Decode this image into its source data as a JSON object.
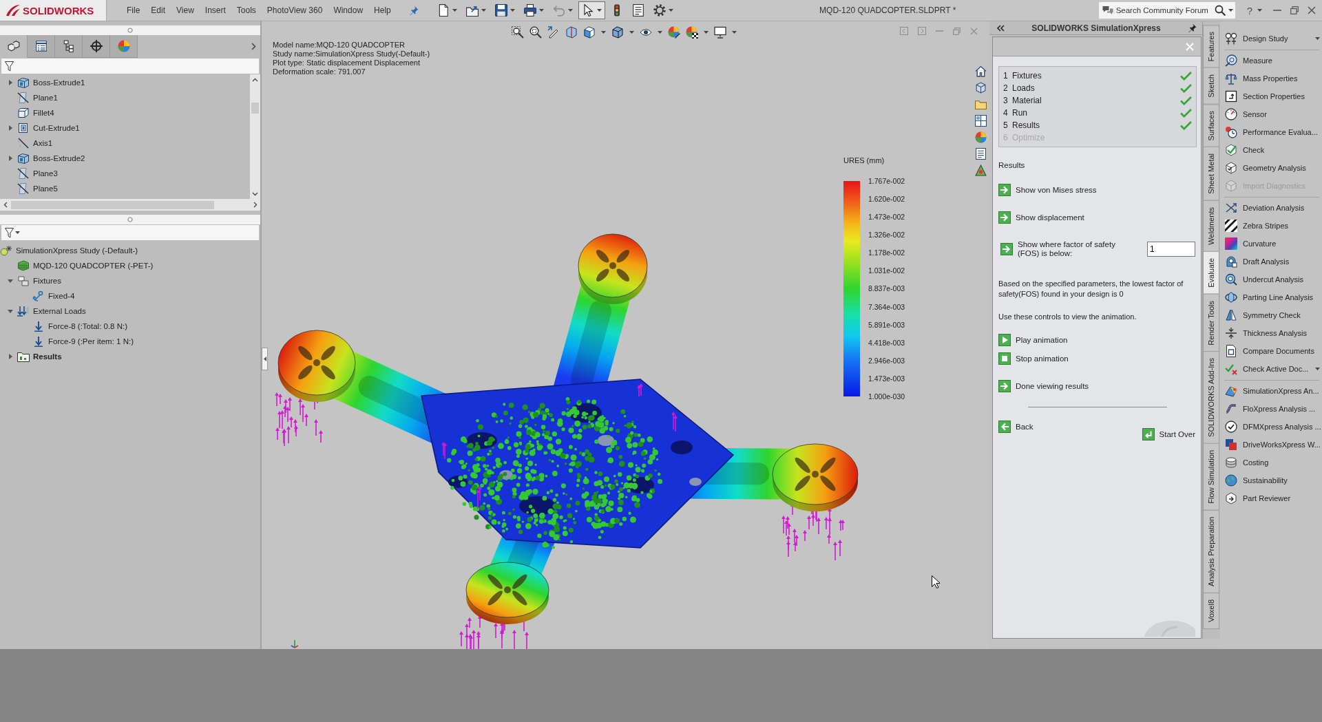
{
  "window": {
    "logo": "SOLIDWORKS",
    "title": "MQD-120 QUADCOPTER.SLDPRT *",
    "help": "?"
  },
  "menu": [
    "File",
    "Edit",
    "View",
    "Insert",
    "Tools",
    "PhotoView 360",
    "Window",
    "Help"
  ],
  "toolbar": [
    {
      "kind": "new",
      "dropdown": true,
      "disabled": false,
      "pressed": false
    },
    {
      "kind": "open",
      "dropdown": true,
      "disabled": false,
      "pressed": false
    },
    {
      "kind": "save",
      "dropdown": true,
      "disabled": false,
      "pressed": false
    },
    {
      "kind": "print",
      "dropdown": true,
      "disabled": false,
      "pressed": false
    },
    {
      "kind": "undo",
      "dropdown": true,
      "disabled": true,
      "pressed": false
    },
    {
      "kind": "select",
      "dropdown": true,
      "disabled": false,
      "pressed": true
    },
    {
      "kind": "rebuild",
      "dropdown": false,
      "disabled": false,
      "pressed": false
    },
    {
      "kind": "properties",
      "dropdown": false,
      "disabled": false,
      "pressed": false
    },
    {
      "kind": "options",
      "dropdown": true,
      "disabled": false,
      "pressed": false
    }
  ],
  "search": {
    "placeholder": "Search Community Forum"
  },
  "feature_manager": {
    "tabs": [
      {
        "kind": "features",
        "selected": true
      },
      {
        "kind": "properties",
        "selected": false
      },
      {
        "kind": "configurations",
        "selected": false
      },
      {
        "kind": "dimxpert",
        "selected": false
      },
      {
        "kind": "display",
        "selected": false
      }
    ],
    "tree": [
      {
        "kind": "extrude",
        "label": "Boss-Extrude1",
        "expanded": false
      },
      {
        "kind": "plane",
        "label": "Plane1"
      },
      {
        "kind": "fillet",
        "label": "Fillet4"
      },
      {
        "kind": "cut",
        "label": "Cut-Extrude1",
        "expanded": false
      },
      {
        "kind": "axis",
        "label": "Axis1"
      },
      {
        "kind": "extrude",
        "label": "Boss-Extrude2",
        "expanded": false
      },
      {
        "kind": "plane",
        "label": "Plane3"
      },
      {
        "kind": "plane",
        "label": "Plane5"
      }
    ]
  },
  "study_tree": [
    {
      "kind": "study",
      "label": "SimulationXpress Study (-Default-)",
      "children": [
        {
          "kind": "part",
          "label": "MQD-120 QUADCOPTER (-PET-)"
        },
        {
          "kind": "fixtures",
          "label": "Fixtures",
          "expanded": true,
          "children": [
            {
              "kind": "fixed",
              "label": "Fixed-4"
            }
          ]
        },
        {
          "kind": "loads",
          "label": "External Loads",
          "expanded": true,
          "children": [
            {
              "kind": "force",
              "label": "Force-8 (:Total: 0.8 N:)"
            },
            {
              "kind": "force",
              "label": "Force-9 (:Per item: 1 N:)"
            }
          ]
        },
        {
          "kind": "results",
          "label": "Results",
          "expanded": false
        }
      ]
    }
  ],
  "viewport": {
    "plot_info": [
      "Model name:MQD-120 QUADCOPTER",
      "Study name:SimulationXpress Study(-Default-)",
      "Plot type: Static displacement Displacement",
      "Deformation scale: 791.007"
    ],
    "legend": {
      "title": "URES (mm)",
      "labels": [
        "1.767e-002",
        "1.620e-002",
        "1.473e-002",
        "1.326e-002",
        "1.178e-002",
        "1.031e-002",
        "8.837e-003",
        "7.364e-003",
        "5.891e-003",
        "4.418e-003",
        "2.946e-003",
        "1.473e-003",
        "1.000e-030"
      ]
    }
  },
  "simulation_xpress": {
    "title": "SOLIDWORKS SimulationXpress",
    "steps": [
      {
        "number": "1",
        "label": "Fixtures",
        "completed": true,
        "disabled": false
      },
      {
        "number": "2",
        "label": "Loads",
        "completed": true,
        "disabled": false
      },
      {
        "number": "3",
        "label": "Material",
        "completed": true,
        "disabled": false
      },
      {
        "number": "4",
        "label": "Run",
        "completed": true,
        "disabled": false
      },
      {
        "number": "5",
        "label": "Results",
        "completed": true,
        "disabled": false
      },
      {
        "number": "6",
        "label": "Optimize",
        "completed": false,
        "disabled": true
      }
    ],
    "results_heading": "Results",
    "actions": [
      {
        "kind": "link",
        "label": "Show von Mises stress"
      },
      {
        "kind": "link",
        "label": "Show displacement"
      },
      {
        "kind": "threshold",
        "label": "Show where factor of safety (FOS) is below:",
        "value": "1"
      }
    ],
    "summary": "Based on the specified parameters, the lowest factor of safety(FOS) found in your design is 0",
    "animation_hint": "Use these controls to view the animation.",
    "animation_controls": [
      {
        "kind": "play",
        "label": "Play animation"
      },
      {
        "kind": "stop",
        "label": "Stop animation"
      }
    ],
    "done": "Done viewing results",
    "back": "Back",
    "start_over": "Start Over"
  },
  "command_manager": {
    "tabs": [
      {
        "label": "Features",
        "selected": false
      },
      {
        "label": "Sketch",
        "selected": false
      },
      {
        "label": "Surfaces",
        "selected": false
      },
      {
        "label": "Sheet Metal",
        "selected": false
      },
      {
        "label": "Weldments",
        "selected": false
      },
      {
        "label": "Evaluate",
        "selected": true
      },
      {
        "label": "Render Tools",
        "selected": false
      },
      {
        "label": "SOLIDWORKS Add-Ins",
        "selected": false
      },
      {
        "label": "Flow Simulation",
        "selected": false
      },
      {
        "label": "Analysis Preparation",
        "selected": false
      },
      {
        "label": "Voxel8",
        "selected": false
      }
    ],
    "groups": [
      [
        {
          "label": "Design Study",
          "dropdown": true,
          "disabled": false
        }
      ],
      [
        {
          "label": "Measure",
          "dropdown": false,
          "disabled": false
        },
        {
          "label": "Mass Properties",
          "dropdown": false,
          "disabled": false
        },
        {
          "label": "Section Properties",
          "dropdown": false,
          "disabled": false
        },
        {
          "label": "Sensor",
          "dropdown": false,
          "disabled": false
        },
        {
          "label": "Performance Evalua...",
          "dropdown": false,
          "disabled": false
        },
        {
          "label": "Check",
          "dropdown": false,
          "disabled": false
        },
        {
          "label": "Geometry Analysis",
          "dropdown": false,
          "disabled": false
        },
        {
          "label": "Import Diagnostics",
          "dropdown": false,
          "disabled": true
        }
      ],
      [
        {
          "label": "Deviation Analysis",
          "dropdown": false,
          "disabled": false
        },
        {
          "label": "Zebra Stripes",
          "dropdown": false,
          "disabled": false
        },
        {
          "label": "Curvature",
          "dropdown": false,
          "disabled": false
        },
        {
          "label": "Draft Analysis",
          "dropdown": false,
          "disabled": false
        },
        {
          "label": "Undercut Analysis",
          "dropdown": false,
          "disabled": false
        },
        {
          "label": "Parting Line Analysis",
          "dropdown": false,
          "disabled": false
        },
        {
          "label": "Symmetry Check",
          "dropdown": false,
          "disabled": false
        },
        {
          "label": "Thickness Analysis",
          "dropdown": false,
          "disabled": false
        },
        {
          "label": "Compare Documents",
          "dropdown": false,
          "disabled": false
        },
        {
          "label": "Check Active Doc...",
          "dropdown": true,
          "disabled": false
        }
      ],
      [
        {
          "label": "SimulationXpress An...",
          "dropdown": false,
          "disabled": false
        },
        {
          "label": "FloXpress Analysis ...",
          "dropdown": false,
          "disabled": false
        },
        {
          "label": "DFMXpress Analysis ...",
          "dropdown": false,
          "disabled": false
        },
        {
          "label": "DriveWorksXpress W...",
          "dropdown": false,
          "disabled": false
        },
        {
          "label": "Costing",
          "dropdown": false,
          "disabled": false
        },
        {
          "label": "Sustainability",
          "dropdown": false,
          "disabled": false
        },
        {
          "label": "Part Reviewer",
          "dropdown": false,
          "disabled": false
        }
      ]
    ]
  }
}
